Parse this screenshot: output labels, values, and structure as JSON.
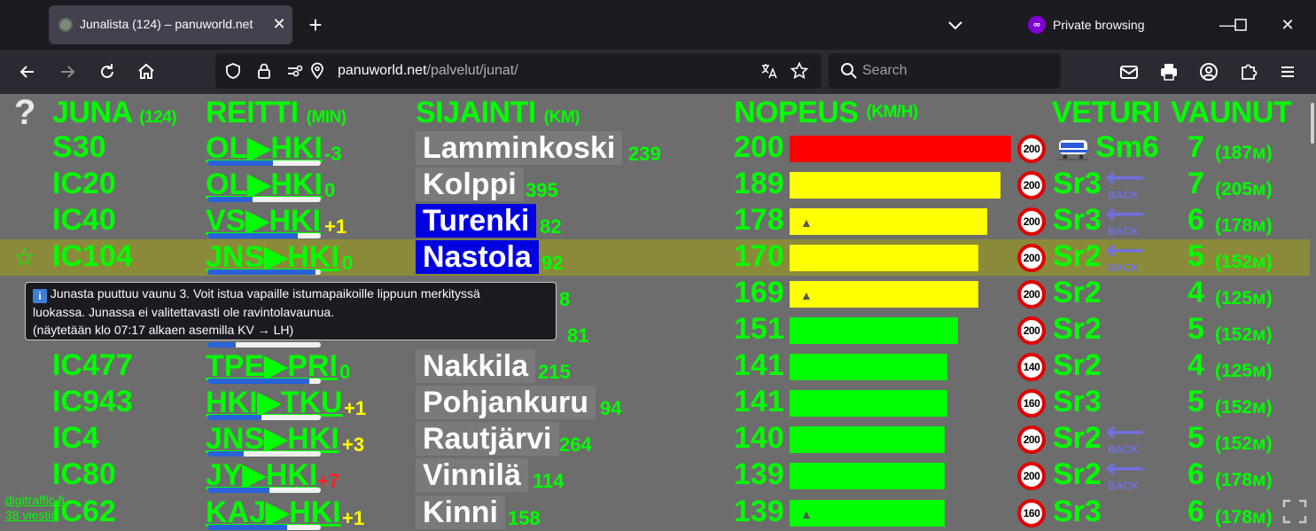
{
  "tab": {
    "title": "Junalista (124) – panuworld.net"
  },
  "private_label": "Private browsing",
  "url": {
    "domain": "panuworld.net",
    "path": "/palvelut/junat/"
  },
  "search": {
    "placeholder": "Search"
  },
  "header": {
    "help": "?",
    "juna": "JUNA",
    "juna_count": "(124)",
    "reitti": "REITTI",
    "reitti_unit": "(MIN)",
    "sijainti": "SIJAINTI",
    "sijainti_unit": "(KM)",
    "nopeus": "NOPEUS",
    "nopeus_unit": "(KM/H)",
    "veturi": "VETURI",
    "vaunut": "VAUNUT"
  },
  "colors": {
    "green": "#00ff00",
    "red_bar": "#ff0000",
    "yellow_bar": "#ffff00",
    "green_bar": "#00ff00",
    "blue_loc": "#0000e0",
    "highlight": "#8a8a3a",
    "progress": "#2962d9"
  },
  "trains": [
    {
      "juna": "S30",
      "route": "OL▶HKI",
      "delay": "-3",
      "delay_color": "#00ff00",
      "progress": 0.58,
      "location": "Lamminkoski",
      "loc_blue": false,
      "km": "239",
      "speed": "200",
      "bar_color": "#ff0000",
      "bar_fraction": 1.0,
      "limit": "200",
      "loco": "Sm6",
      "loco_icon": "tram-icon",
      "back": false,
      "wagons": "7",
      "length": "(187м)",
      "highlight": false,
      "triangle": false
    },
    {
      "juna": "IC20",
      "route": "OL▶HKI",
      "delay": "0",
      "delay_color": "#00ff00",
      "progress": 0.4,
      "location": "Kolppi",
      "loc_blue": false,
      "km": "395",
      "speed": "189",
      "bar_color": "#ffff00",
      "bar_fraction": 0.95,
      "limit": "200",
      "loco": "Sr3",
      "loco_icon": "",
      "back": true,
      "wagons": "7",
      "length": "(205м)",
      "highlight": false,
      "triangle": false
    },
    {
      "juna": "IC40",
      "route": "VS▶HKI",
      "delay": "+1",
      "delay_color": "#ffff00",
      "progress": 0.8,
      "location": "Turenki",
      "loc_blue": true,
      "km": "82",
      "speed": "178",
      "bar_color": "#ffff00",
      "bar_fraction": 0.89,
      "limit": "200",
      "loco": "Sr3",
      "loco_icon": "",
      "back": true,
      "wagons": "6",
      "length": "(178м)",
      "highlight": false,
      "triangle": true
    },
    {
      "juna": "IC104",
      "route": "JNS▶HKI",
      "delay": "0",
      "delay_color": "#00ff00",
      "progress": 0.95,
      "location": "Nastola",
      "loc_blue": true,
      "km": "92",
      "speed": "170",
      "bar_color": "#ffff00",
      "bar_fraction": 0.85,
      "limit": "200",
      "loco": "Sr2",
      "loco_icon": "",
      "back": true,
      "wagons": "5",
      "length": "(152м)",
      "highlight": true,
      "triangle": false
    },
    {
      "juna": "",
      "route": "",
      "delay": "",
      "delay_color": "#00ff00",
      "progress": 0.0,
      "location": "",
      "loc_blue": false,
      "km": "8",
      "speed": "169",
      "bar_color": "#ffff00",
      "bar_fraction": 0.85,
      "limit": "200",
      "loco": "Sr2",
      "loco_icon": "",
      "back": false,
      "wagons": "4",
      "length": "(125м)",
      "highlight": false,
      "triangle": true
    },
    {
      "juna": "",
      "route": "",
      "delay": "",
      "delay_color": "#00ff00",
      "progress": 0.25,
      "location": "",
      "loc_blue": false,
      "km": "81",
      "speed": "151",
      "bar_color": "#00ff00",
      "bar_fraction": 0.76,
      "limit": "200",
      "loco": "Sr2",
      "loco_icon": "",
      "back": false,
      "wagons": "5",
      "length": "(152м)",
      "highlight": false,
      "triangle": false
    },
    {
      "juna": "IC477",
      "route": "TPE▶PRI",
      "delay": "0",
      "delay_color": "#00ff00",
      "progress": 0.9,
      "location": "Nakkila",
      "loc_blue": false,
      "km": "215",
      "speed": "141",
      "bar_color": "#00ff00",
      "bar_fraction": 0.71,
      "limit": "140",
      "loco": "Sr2",
      "loco_icon": "",
      "back": false,
      "wagons": "4",
      "length": "(125м)",
      "highlight": false,
      "triangle": false
    },
    {
      "juna": "IC943",
      "route": "HKI▶TKU",
      "delay": "+1",
      "delay_color": "#ffff00",
      "progress": 0.48,
      "location": "Pohjankuru",
      "loc_blue": false,
      "km": "94",
      "speed": "141",
      "bar_color": "#00ff00",
      "bar_fraction": 0.71,
      "limit": "160",
      "loco": "Sr3",
      "loco_icon": "",
      "back": false,
      "wagons": "5",
      "length": "(152м)",
      "highlight": false,
      "triangle": false
    },
    {
      "juna": "IC4",
      "route": "JNS▶HKI",
      "delay": "+3",
      "delay_color": "#ffff00",
      "progress": 0.32,
      "location": "Rautjärvi",
      "loc_blue": false,
      "km": "264",
      "speed": "140",
      "bar_color": "#00ff00",
      "bar_fraction": 0.7,
      "limit": "200",
      "loco": "Sr2",
      "loco_icon": "",
      "back": true,
      "wagons": "5",
      "length": "(152м)",
      "highlight": false,
      "triangle": false
    },
    {
      "juna": "IC80",
      "route": "JY▶HKI",
      "delay": "+7",
      "delay_color": "#ff2020",
      "progress": 0.55,
      "location": "Vinnilä",
      "loc_blue": false,
      "km": "114",
      "speed": "139",
      "bar_color": "#00ff00",
      "bar_fraction": 0.7,
      "limit": "200",
      "loco": "Sr2",
      "loco_icon": "",
      "back": true,
      "wagons": "6",
      "length": "(178м)",
      "highlight": false,
      "triangle": false
    },
    {
      "juna": "IC62",
      "route": "KAJ▶HKI",
      "delay": "+1",
      "delay_color": "#ffff00",
      "progress": 0.7,
      "location": "Kinni",
      "loc_blue": false,
      "km": "158",
      "speed": "139",
      "bar_color": "#00ff00",
      "bar_fraction": 0.7,
      "limit": "160",
      "loco": "Sr3",
      "loco_icon": "",
      "back": false,
      "wagons": "6",
      "length": "(178м)",
      "highlight": false,
      "triangle": true
    }
  ],
  "back_label": "BACK",
  "tooltip": {
    "line1": "Junasta puuttuu vaunu 3.  Voit istua vapaille istumapaikoille lippuun merkityssä",
    "line2": "luokassa.  Junassa ei valitettavasti ole ravintolavaunua.",
    "line3": "(näytetään klo 07:17 alkaen asemilla KV → LH)"
  },
  "footer": {
    "source": "digitraffic.fi",
    "messages": "38 viestiä"
  }
}
